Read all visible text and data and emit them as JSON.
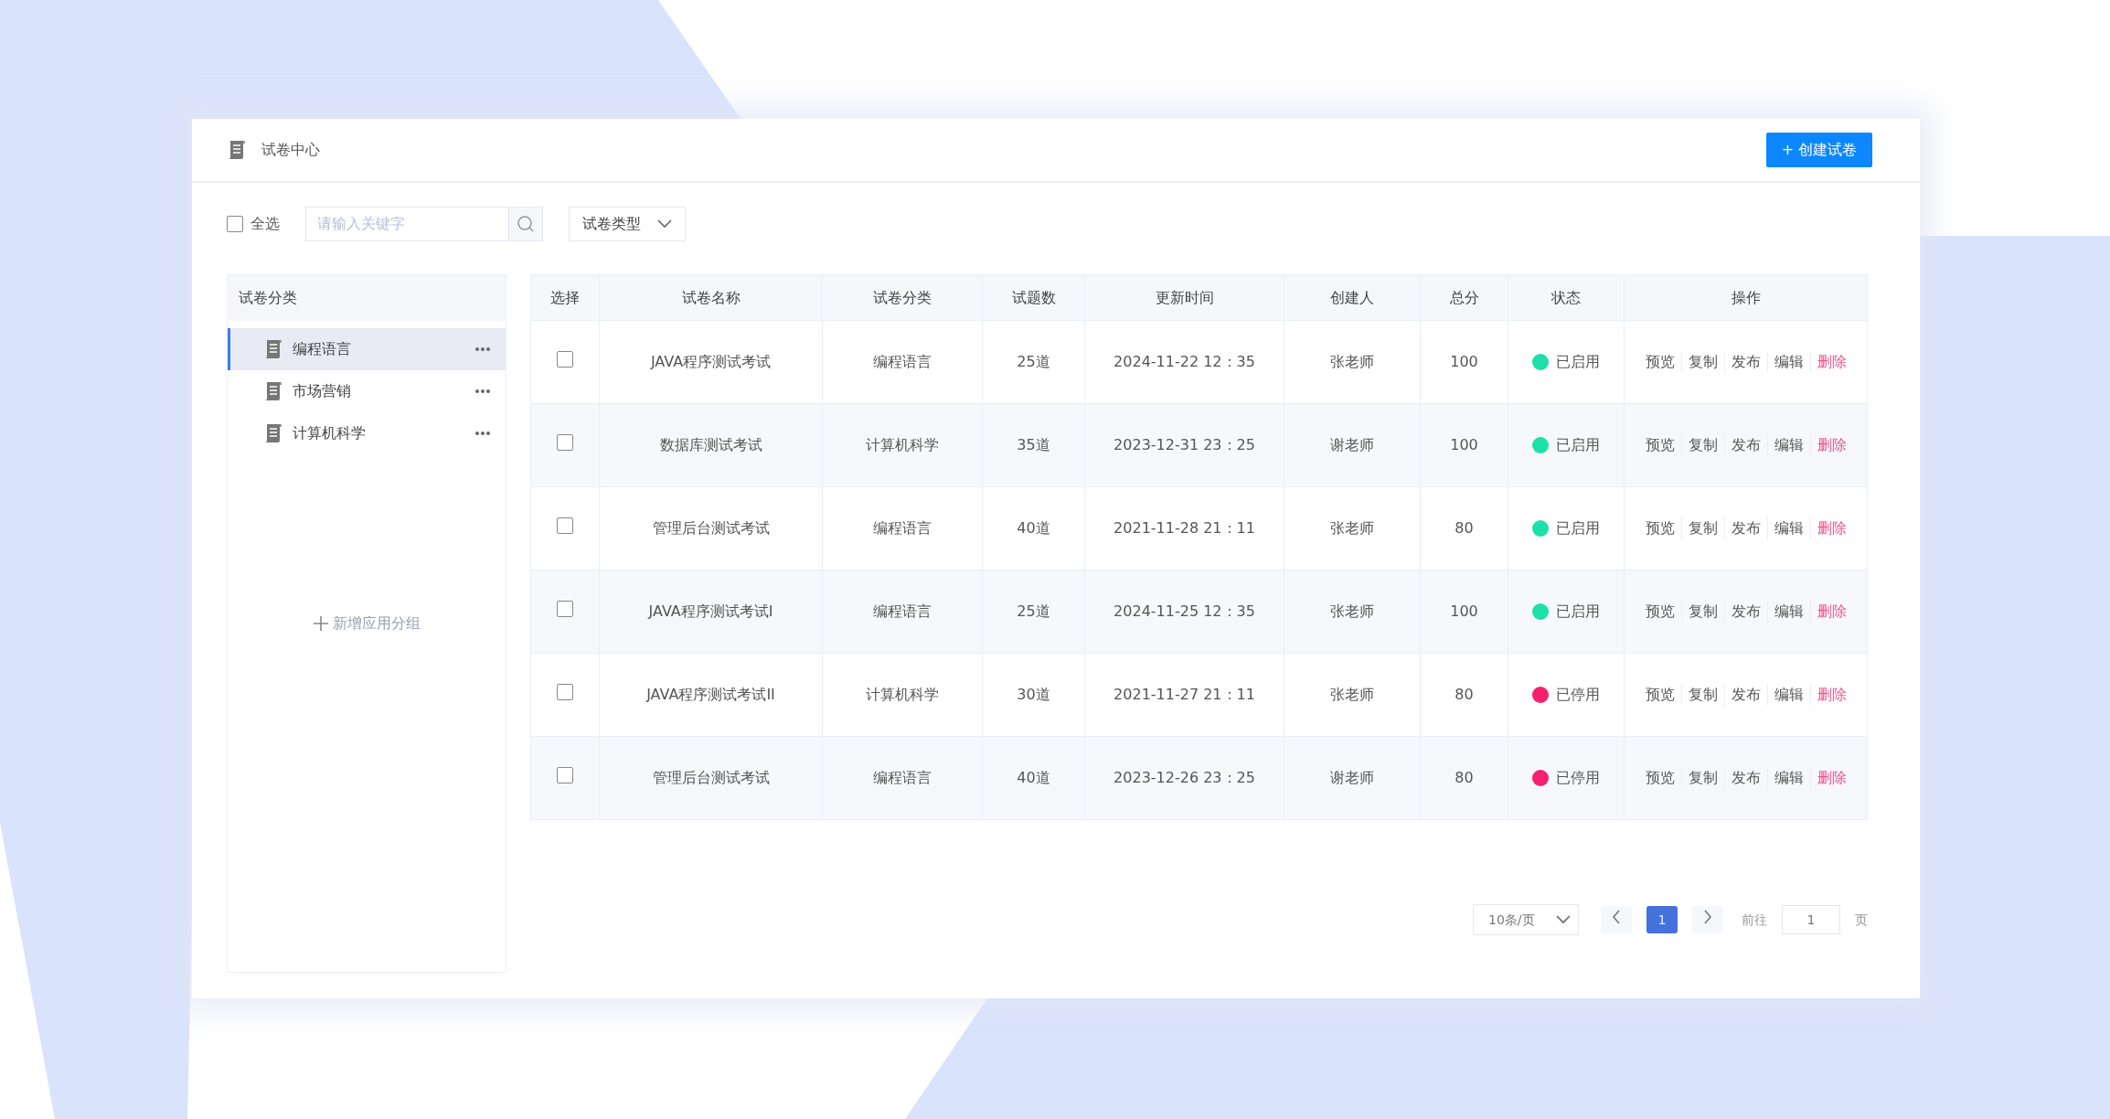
{
  "header": {
    "title": "试卷中心",
    "create_button": "+ 创建试卷"
  },
  "toolbar": {
    "select_all": {
      "label": "全选",
      "checked": false
    },
    "search": {
      "placeholder": "请输入关键字"
    },
    "type_filter": "试卷类型"
  },
  "sidebar": {
    "title": "试卷分类",
    "items": [
      {
        "label": "编程语言",
        "selected": true
      },
      {
        "label": "市场营销",
        "selected": false
      },
      {
        "label": "计算机科学",
        "selected": false
      }
    ],
    "add_group": "新增应用分组"
  },
  "table": {
    "columns": [
      "选择",
      "试卷名称",
      "试卷分类",
      "试题数",
      "更新时间",
      "创建人",
      "总分",
      "状态",
      "操作"
    ],
    "rows": [
      {
        "checked": false,
        "name": "JAVA程序测试考试",
        "category": "编程语言",
        "questions": "25道",
        "updated": "2024-11-22 12：35",
        "creator": "张老师",
        "score": "100",
        "status": "已启用",
        "color": "#1de0a8",
        "actions": [
          {
            "label": "预览",
            "kind": "normal"
          },
          {
            "label": "复制",
            "kind": "normal"
          },
          {
            "label": "发布",
            "kind": "normal"
          },
          {
            "label": "编辑",
            "kind": "normal"
          },
          {
            "label": "删除",
            "kind": "danger"
          }
        ]
      },
      {
        "checked": false,
        "name": "数据库测试考试",
        "category": "计算机科学",
        "questions": "35道",
        "updated": "2023-12-31 23：25",
        "creator": "谢老师",
        "score": "100",
        "status": "已启用",
        "color": "#1de0a8",
        "actions": [
          {
            "label": "预览",
            "kind": "normal"
          },
          {
            "label": "复制",
            "kind": "normal"
          },
          {
            "label": "发布",
            "kind": "normal"
          },
          {
            "label": "编辑",
            "kind": "normal"
          },
          {
            "label": "删除",
            "kind": "danger"
          }
        ]
      },
      {
        "checked": false,
        "name": "管理后台测试考试",
        "category": "编程语言",
        "questions": "40道",
        "updated": "2021-11-28 21：11",
        "creator": "张老师",
        "score": "80",
        "status": "已启用",
        "color": "#1de0a8",
        "actions": [
          {
            "label": "预览",
            "kind": "normal"
          },
          {
            "label": "复制",
            "kind": "normal"
          },
          {
            "label": "发布",
            "kind": "normal"
          },
          {
            "label": "编辑",
            "kind": "normal"
          },
          {
            "label": "删除",
            "kind": "danger"
          }
        ]
      },
      {
        "checked": false,
        "name": "JAVA程序测试考试I",
        "category": "编程语言",
        "questions": "25道",
        "updated": "2024-11-25 12：35",
        "creator": "张老师",
        "score": "100",
        "status": "已启用",
        "color": "#1de0a8",
        "actions": [
          {
            "label": "预览",
            "kind": "normal"
          },
          {
            "label": "复制",
            "kind": "normal"
          },
          {
            "label": "发布",
            "kind": "normal"
          },
          {
            "label": "编辑",
            "kind": "normal"
          },
          {
            "label": "删除",
            "kind": "danger"
          }
        ]
      },
      {
        "checked": false,
        "name": "JAVA程序测试考试II",
        "category": "计算机科学",
        "questions": "30道",
        "updated": "2021-11-27 21：11",
        "creator": "张老师",
        "score": "80",
        "status": "已停用",
        "color": "#f5206e",
        "actions": [
          {
            "label": "预览",
            "kind": "normal"
          },
          {
            "label": "复制",
            "kind": "normal"
          },
          {
            "label": "发布",
            "kind": "normal"
          },
          {
            "label": "编辑",
            "kind": "normal"
          },
          {
            "label": "删除",
            "kind": "danger"
          }
        ]
      },
      {
        "checked": false,
        "name": "管理后台测试考试",
        "category": "编程语言",
        "questions": "40道",
        "updated": "2023-12-26 23：25",
        "creator": "谢老师",
        "score": "80",
        "status": "已停用",
        "color": "#f5206e",
        "actions": [
          {
            "label": "预览",
            "kind": "normal"
          },
          {
            "label": "复制",
            "kind": "normal"
          },
          {
            "label": "发布",
            "kind": "normal"
          },
          {
            "label": "编辑",
            "kind": "normal"
          },
          {
            "label": "删除",
            "kind": "danger"
          }
        ]
      }
    ]
  },
  "pagination": {
    "page_size": "10条/页",
    "pages": [
      {
        "label": "1",
        "selected": true
      }
    ],
    "goto_label": "前往",
    "goto_value": "1",
    "page_suffix": "页"
  }
}
